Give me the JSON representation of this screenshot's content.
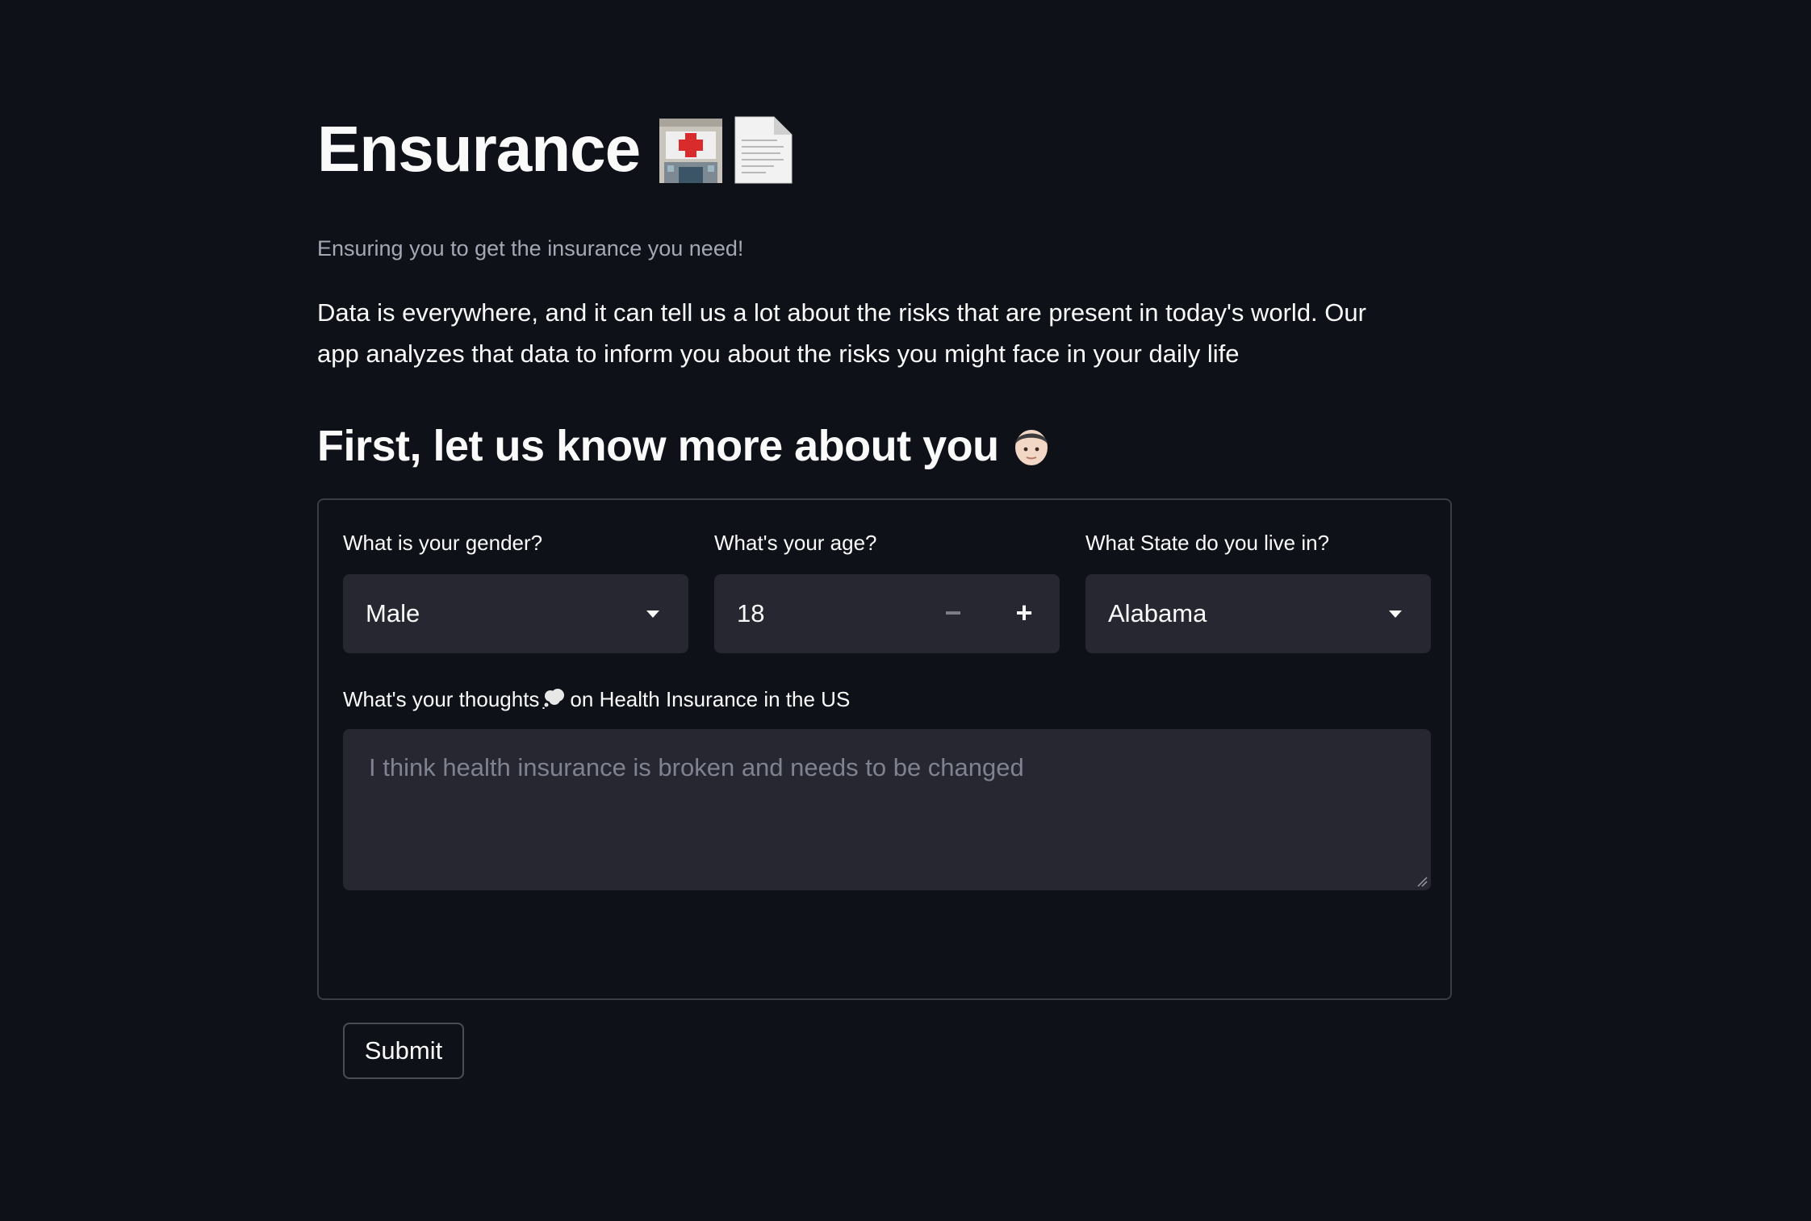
{
  "header": {
    "title": "Ensurance",
    "title_icons": [
      "hospital-icon",
      "document-icon"
    ],
    "subtitle": "Ensuring you to get the insurance you need!",
    "intro": "Data is everywhere, and it can tell us a lot about the risks that are present in today's world. Our app analyzes that data to inform you about the risks you might face in your daily life"
  },
  "section": {
    "title": "First, let us know more about you",
    "icon": "person-icon"
  },
  "form": {
    "gender": {
      "label": "What is your gender?",
      "value": "Male"
    },
    "age": {
      "label": "What's your age?",
      "value": "18",
      "decrement_label": "−",
      "increment_label": "+"
    },
    "state": {
      "label": "What State do you live in?",
      "value": "Alabama"
    },
    "thoughts": {
      "label_before": "What's your thoughts",
      "label_icon": "thought-balloon-icon",
      "label_after": "on Health Insurance in the US",
      "placeholder": "I think health insurance is broken and needs to be changed"
    },
    "submit_label": "Submit"
  },
  "colors": {
    "background": "#0e1117",
    "input_background": "#262730",
    "text": "#fafafa",
    "muted_text": "#a3a8b4",
    "border": "#3a3d45"
  }
}
